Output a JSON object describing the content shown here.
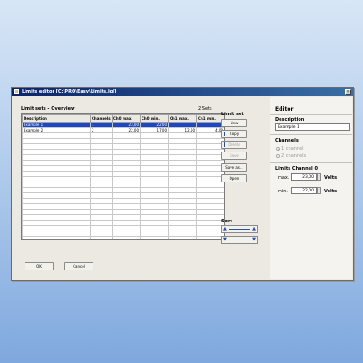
{
  "window": {
    "title": "Limits editor [C:\\PRO\\Easy\\Limits.lgl]",
    "close_glyph": "x"
  },
  "overview": {
    "heading": "Limit sets - Overview",
    "count": "2 Sets",
    "columns": [
      "Description",
      "Channels",
      "Ch0 max.",
      "Ch0 min.",
      "Ch1 max.",
      "Ch1 min."
    ],
    "rows": [
      {
        "description": "Example 1",
        "channels": "1",
        "ch0_max": "23,00",
        "ch0_min": "22,00",
        "ch1_max": "",
        "ch1_min": "",
        "selected": true
      },
      {
        "description": "Example 2",
        "channels": "2",
        "ch0_max": "22,00",
        "ch0_min": "17,00",
        "ch1_max": "12,00",
        "ch1_min": "4,00",
        "selected": false
      }
    ],
    "empty_rows": 23
  },
  "limit_set": {
    "heading": "Limit set",
    "buttons": [
      {
        "label": "New",
        "enabled": true
      },
      {
        "label": "Copy",
        "enabled": true
      },
      {
        "label": "Delete",
        "enabled": false
      },
      {
        "label": "Save",
        "enabled": false
      },
      {
        "label": "Save as...",
        "enabled": true
      },
      {
        "label": "Open",
        "enabled": true
      }
    ]
  },
  "sort": {
    "heading": "Sort"
  },
  "editor": {
    "heading": "Editor",
    "description_label": "Description",
    "description_value": "Example 1",
    "channels_label": "Channels",
    "channel_options": [
      "1 channel",
      "2 channels"
    ],
    "channel_selected": "1 channel",
    "limits_label": "Limits Channel 0",
    "max_label": "max.",
    "max_value": "23,00",
    "min_label": "min.",
    "min_value": "22,00",
    "unit": "Volts"
  },
  "footer": {
    "ok_label": "OK",
    "cancel_label": "Cancel"
  },
  "colors": {
    "selection": "#1c48c8",
    "titlebar": "#0a246a",
    "accent": "#2b4fa8"
  }
}
